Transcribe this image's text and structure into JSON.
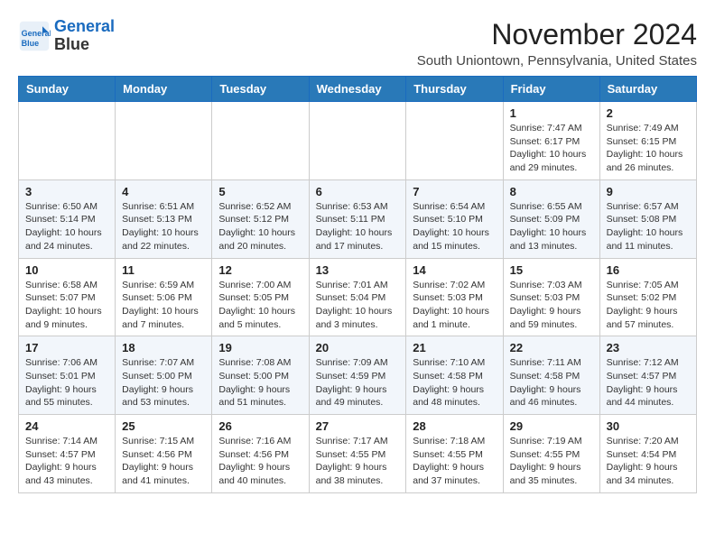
{
  "header": {
    "logo_line1": "General",
    "logo_line2": "Blue",
    "month_title": "November 2024",
    "subtitle": "South Uniontown, Pennsylvania, United States"
  },
  "weekdays": [
    "Sunday",
    "Monday",
    "Tuesday",
    "Wednesday",
    "Thursday",
    "Friday",
    "Saturday"
  ],
  "weeks": [
    [
      {
        "day": "",
        "info": ""
      },
      {
        "day": "",
        "info": ""
      },
      {
        "day": "",
        "info": ""
      },
      {
        "day": "",
        "info": ""
      },
      {
        "day": "",
        "info": ""
      },
      {
        "day": "1",
        "info": "Sunrise: 7:47 AM\nSunset: 6:17 PM\nDaylight: 10 hours and 29 minutes."
      },
      {
        "day": "2",
        "info": "Sunrise: 7:49 AM\nSunset: 6:15 PM\nDaylight: 10 hours and 26 minutes."
      }
    ],
    [
      {
        "day": "3",
        "info": "Sunrise: 6:50 AM\nSunset: 5:14 PM\nDaylight: 10 hours and 24 minutes."
      },
      {
        "day": "4",
        "info": "Sunrise: 6:51 AM\nSunset: 5:13 PM\nDaylight: 10 hours and 22 minutes."
      },
      {
        "day": "5",
        "info": "Sunrise: 6:52 AM\nSunset: 5:12 PM\nDaylight: 10 hours and 20 minutes."
      },
      {
        "day": "6",
        "info": "Sunrise: 6:53 AM\nSunset: 5:11 PM\nDaylight: 10 hours and 17 minutes."
      },
      {
        "day": "7",
        "info": "Sunrise: 6:54 AM\nSunset: 5:10 PM\nDaylight: 10 hours and 15 minutes."
      },
      {
        "day": "8",
        "info": "Sunrise: 6:55 AM\nSunset: 5:09 PM\nDaylight: 10 hours and 13 minutes."
      },
      {
        "day": "9",
        "info": "Sunrise: 6:57 AM\nSunset: 5:08 PM\nDaylight: 10 hours and 11 minutes."
      }
    ],
    [
      {
        "day": "10",
        "info": "Sunrise: 6:58 AM\nSunset: 5:07 PM\nDaylight: 10 hours and 9 minutes."
      },
      {
        "day": "11",
        "info": "Sunrise: 6:59 AM\nSunset: 5:06 PM\nDaylight: 10 hours and 7 minutes."
      },
      {
        "day": "12",
        "info": "Sunrise: 7:00 AM\nSunset: 5:05 PM\nDaylight: 10 hours and 5 minutes."
      },
      {
        "day": "13",
        "info": "Sunrise: 7:01 AM\nSunset: 5:04 PM\nDaylight: 10 hours and 3 minutes."
      },
      {
        "day": "14",
        "info": "Sunrise: 7:02 AM\nSunset: 5:03 PM\nDaylight: 10 hours and 1 minute."
      },
      {
        "day": "15",
        "info": "Sunrise: 7:03 AM\nSunset: 5:03 PM\nDaylight: 9 hours and 59 minutes."
      },
      {
        "day": "16",
        "info": "Sunrise: 7:05 AM\nSunset: 5:02 PM\nDaylight: 9 hours and 57 minutes."
      }
    ],
    [
      {
        "day": "17",
        "info": "Sunrise: 7:06 AM\nSunset: 5:01 PM\nDaylight: 9 hours and 55 minutes."
      },
      {
        "day": "18",
        "info": "Sunrise: 7:07 AM\nSunset: 5:00 PM\nDaylight: 9 hours and 53 minutes."
      },
      {
        "day": "19",
        "info": "Sunrise: 7:08 AM\nSunset: 5:00 PM\nDaylight: 9 hours and 51 minutes."
      },
      {
        "day": "20",
        "info": "Sunrise: 7:09 AM\nSunset: 4:59 PM\nDaylight: 9 hours and 49 minutes."
      },
      {
        "day": "21",
        "info": "Sunrise: 7:10 AM\nSunset: 4:58 PM\nDaylight: 9 hours and 48 minutes."
      },
      {
        "day": "22",
        "info": "Sunrise: 7:11 AM\nSunset: 4:58 PM\nDaylight: 9 hours and 46 minutes."
      },
      {
        "day": "23",
        "info": "Sunrise: 7:12 AM\nSunset: 4:57 PM\nDaylight: 9 hours and 44 minutes."
      }
    ],
    [
      {
        "day": "24",
        "info": "Sunrise: 7:14 AM\nSunset: 4:57 PM\nDaylight: 9 hours and 43 minutes."
      },
      {
        "day": "25",
        "info": "Sunrise: 7:15 AM\nSunset: 4:56 PM\nDaylight: 9 hours and 41 minutes."
      },
      {
        "day": "26",
        "info": "Sunrise: 7:16 AM\nSunset: 4:56 PM\nDaylight: 9 hours and 40 minutes."
      },
      {
        "day": "27",
        "info": "Sunrise: 7:17 AM\nSunset: 4:55 PM\nDaylight: 9 hours and 38 minutes."
      },
      {
        "day": "28",
        "info": "Sunrise: 7:18 AM\nSunset: 4:55 PM\nDaylight: 9 hours and 37 minutes."
      },
      {
        "day": "29",
        "info": "Sunrise: 7:19 AM\nSunset: 4:55 PM\nDaylight: 9 hours and 35 minutes."
      },
      {
        "day": "30",
        "info": "Sunrise: 7:20 AM\nSunset: 4:54 PM\nDaylight: 9 hours and 34 minutes."
      }
    ]
  ]
}
